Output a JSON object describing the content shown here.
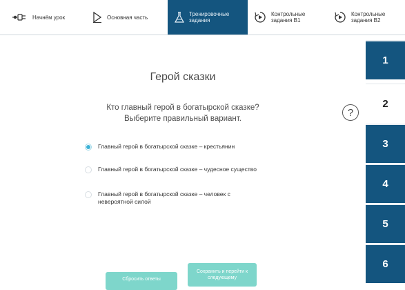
{
  "nav": {
    "items": [
      {
        "label": "Начнём урок",
        "icon": "plug-icon"
      },
      {
        "label": "Основная часть",
        "icon": "play-icon"
      },
      {
        "label": "Тренировочные\nзадания",
        "icon": "flask-icon"
      },
      {
        "label": "Контрольные\nзадания В1",
        "icon": "timer-icon"
      },
      {
        "label": "Контрольные\nзадания В2",
        "icon": "timer-icon"
      }
    ],
    "active_index": 2
  },
  "sidebar": {
    "items": [
      "1",
      "2",
      "3",
      "4",
      "5",
      "6"
    ],
    "active_index": 1
  },
  "main": {
    "title": "Герой сказки",
    "question_line1": "Кто главный герой в богатырской сказке?",
    "question_line2": "Выберите правильный вариант.",
    "help_symbol": "?",
    "options": [
      {
        "text": "Главный герой в богатырской сказке – крестьянин",
        "selected": true
      },
      {
        "text": "Главный герой в богатырской сказке – чудесное существо",
        "selected": false
      },
      {
        "text": "Главный герой в богатырской сказке – человек с невероятной силой",
        "selected": false
      }
    ]
  },
  "buttons": {
    "reset": "Сбросить ответы",
    "save_next": "Сохранить и перейти к следующему"
  },
  "colors": {
    "accent_dark": "#14557f",
    "button": "#7ed6cb",
    "radio_selected": "#3db2d6"
  }
}
